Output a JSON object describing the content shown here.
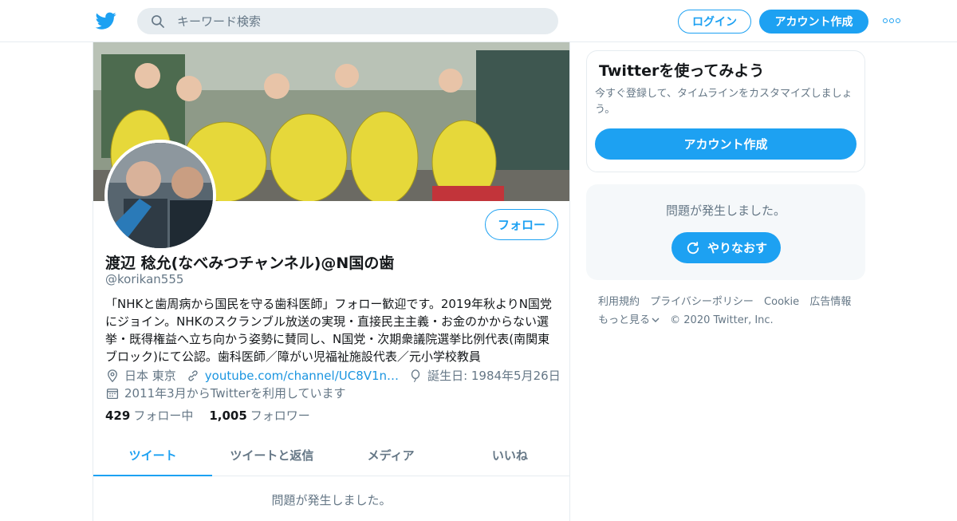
{
  "header": {
    "logo": "twitter-bird-icon",
    "search": {
      "placeholder": "キーワード検索",
      "value": ""
    },
    "login_label": "ログイン",
    "signup_label": "アカウント作成",
    "more": "more-icon"
  },
  "profile": {
    "name": "渡辺 稔允(なべみつチャンネル)@N国の歯",
    "handle": "@korikan555",
    "follow_label": "フォロー",
    "bio": "「NHKと歯周病から国民を守る歯科医師」フォロー歓迎です。2019年秋よりN国党にジョイン。NHKのスクランブル放送の実現・直接民主主義・お金のかからない選挙・既得権益へ立ち向かう姿勢に賛同し、N国党・次期衆議院選挙比例代表(南関東ブロック)にて公認。歯科医師／障がい児福祉施設代表／元小学校教員",
    "location": "日本 東京",
    "url": "youtube.com/channel/UC8V1n…",
    "birthday": "誕生日: 1984年5月26日",
    "joined": "2011年3月からTwitterを利用しています",
    "following_count": "429",
    "following_label": "フォロー中",
    "followers_count": "1,005",
    "followers_label": "フォロワー"
  },
  "tabs": [
    {
      "label": "ツイート",
      "active": true
    },
    {
      "label": "ツイートと返信",
      "active": false
    },
    {
      "label": "メディア",
      "active": false
    },
    {
      "label": "いいね",
      "active": false
    }
  ],
  "timeline_error": "問題が発生しました。",
  "sidebar": {
    "signup_title": "Twitterを使ってみよう",
    "signup_text": "今すぐ登録して、タイムラインをカスタマイズしましょう。",
    "signup_button": "アカウント作成",
    "error_text": "問題が発生しました。",
    "retry_label": "やりなおす"
  },
  "footer": {
    "links": [
      "利用規約",
      "プライバシーポリシー",
      "Cookie",
      "広告情報",
      "もっと見る"
    ],
    "copyright": "© 2020 Twitter, Inc."
  },
  "colors": {
    "accent": "#1da1f2",
    "text": "#14171a",
    "muted": "#657786",
    "border": "#e6ecf0"
  }
}
